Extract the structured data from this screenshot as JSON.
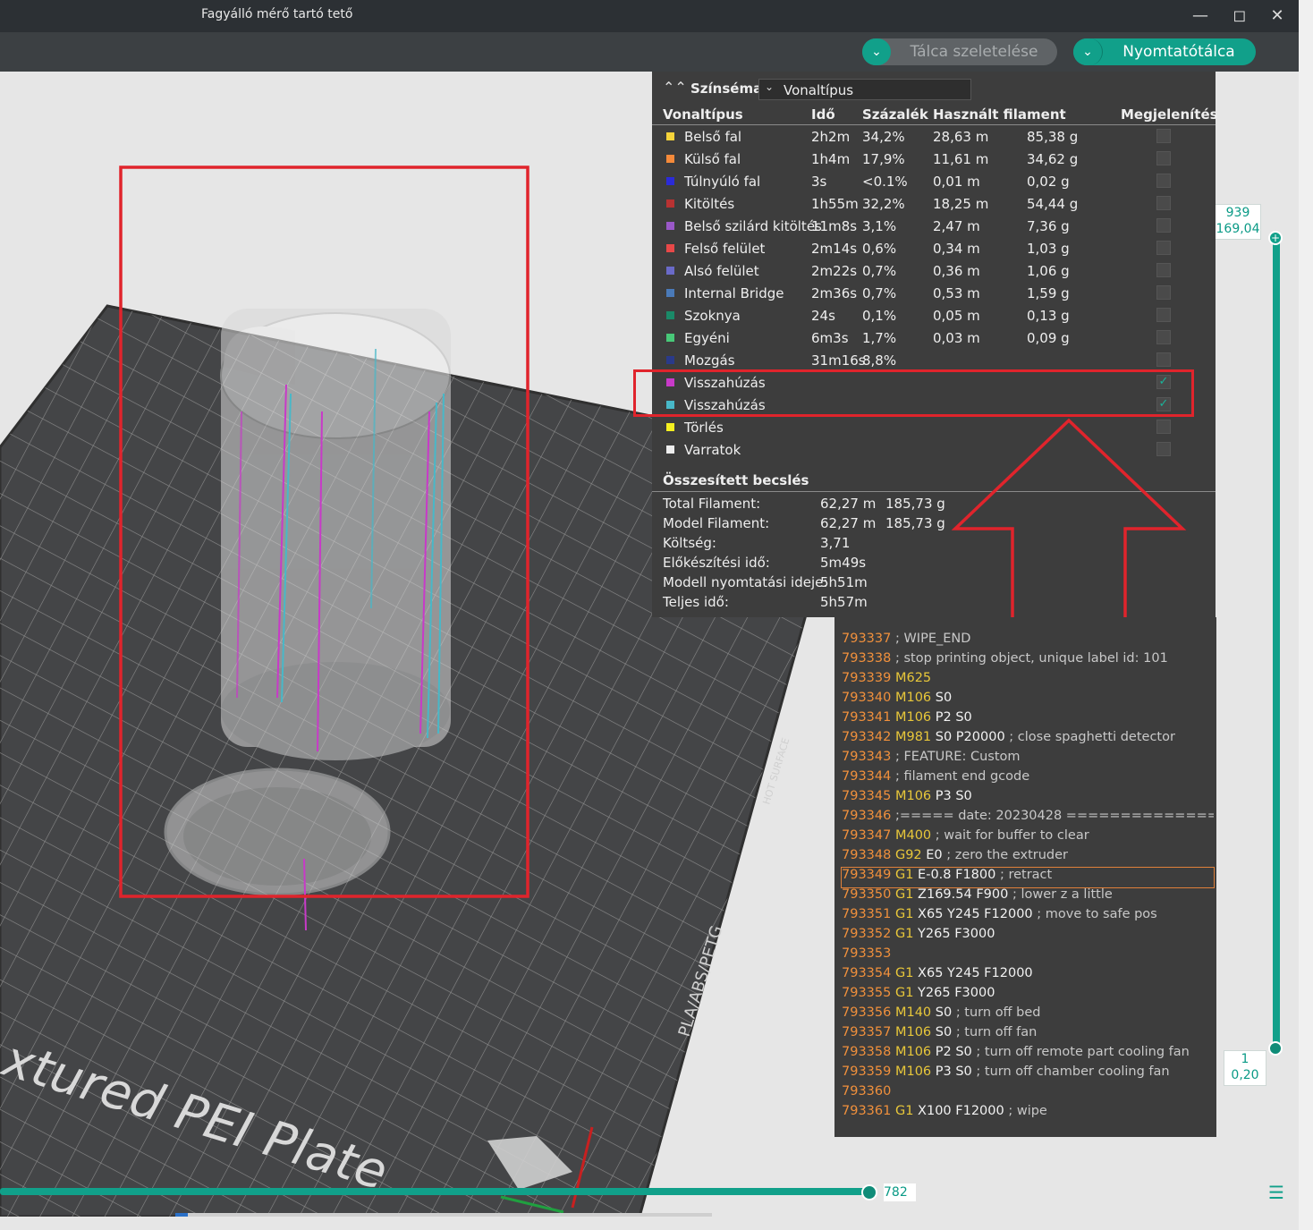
{
  "window": {
    "title": "Fagyálló mérő tartó tető",
    "minimize_icon": "minimize-icon",
    "maximize_icon": "maximize-icon",
    "close_icon": "close-icon"
  },
  "toolbar": {
    "slice_label": "Tálca szeletelése",
    "print_label": "Nyomtatótálca",
    "accent": "#11a08a"
  },
  "plate": {
    "label": "xtured PEI Plate",
    "side_label_1": "PLA/ABS/PETG",
    "side_label_2": "HOT SURFACE"
  },
  "legend": {
    "scheme_label": "Színséma",
    "scheme_value": "Vonaltípus",
    "columns": [
      "Vonaltípus",
      "Idő",
      "Százalék",
      "Használt filament",
      "Megjelenítés"
    ],
    "rows": [
      {
        "color": "#f5d33a",
        "name": "Belső fal",
        "time": "2h2m",
        "percent": "34,2%",
        "length": "28,63 m",
        "weight": "85,38 g",
        "shown": false
      },
      {
        "color": "#f58a3a",
        "name": "Külső fal",
        "time": "1h4m",
        "percent": "17,9%",
        "length": "11,61 m",
        "weight": "34,62 g",
        "shown": false
      },
      {
        "color": "#2b2bd8",
        "name": "Túlnyúló fal",
        "time": "3s",
        "percent": "<0.1%",
        "length": "0,01 m",
        "weight": "0,02 g",
        "shown": false
      },
      {
        "color": "#b83232",
        "name": "Kitöltés",
        "time": "1h55m",
        "percent": "32,2%",
        "length": "18,25 m",
        "weight": "54,44 g",
        "shown": false
      },
      {
        "color": "#9a58c8",
        "name": "Belső szilárd kitöltés",
        "time": "11m8s",
        "percent": "3,1%",
        "length": "2,47 m",
        "weight": "7,36 g",
        "shown": false
      },
      {
        "color": "#e84848",
        "name": "Felső felület",
        "time": "2m14s",
        "percent": "0,6%",
        "length": "0,34 m",
        "weight": "1,03 g",
        "shown": false
      },
      {
        "color": "#6a6ac8",
        "name": "Alsó felület",
        "time": "2m22s",
        "percent": "0,7%",
        "length": "0,36 m",
        "weight": "1,06 g",
        "shown": false
      },
      {
        "color": "#4a7ab8",
        "name": "Internal Bridge",
        "time": "2m36s",
        "percent": "0,7%",
        "length": "0,53 m",
        "weight": "1,59 g",
        "shown": false
      },
      {
        "color": "#1a8a68",
        "name": "Szoknya",
        "time": "24s",
        "percent": "0,1%",
        "length": "0,05 m",
        "weight": "0,13 g",
        "shown": false
      },
      {
        "color": "#48c878",
        "name": "Egyéni",
        "time": "6m3s",
        "percent": "1,7%",
        "length": "0,03 m",
        "weight": "0,09 g",
        "shown": false
      },
      {
        "color": "#2a3a8a",
        "name": "Mozgás",
        "time": "31m16s",
        "percent": "8,8%",
        "length": "",
        "weight": "",
        "shown": false
      },
      {
        "color": "#c83ac8",
        "name": "Visszahúzás",
        "time": "",
        "percent": "",
        "length": "",
        "weight": "",
        "shown": true
      },
      {
        "color": "#48b8c8",
        "name": "Visszahúzás",
        "time": "",
        "percent": "",
        "length": "",
        "weight": "",
        "shown": true
      },
      {
        "color": "#f5f020",
        "name": "Törlés",
        "time": "",
        "percent": "",
        "length": "",
        "weight": "",
        "shown": false
      },
      {
        "color": "#eeeeee",
        "name": "Varratok",
        "time": "",
        "percent": "",
        "length": "",
        "weight": "",
        "shown": false
      }
    ],
    "summary_title": "Összesített becslés",
    "summary": [
      {
        "label": "Total Filament:",
        "value": "62,27 m",
        "extra": "185,73 g"
      },
      {
        "label": "Model Filament:",
        "value": "62,27 m",
        "extra": "185,73 g"
      },
      {
        "label": "Költség:",
        "value": "3,71",
        "extra": ""
      },
      {
        "label": "Előkészítési idő:",
        "value": "5m49s",
        "extra": ""
      },
      {
        "label": "Modell nyomtatási ideje:",
        "value": "5h51m",
        "extra": ""
      },
      {
        "label": "Teljes idő:",
        "value": "5h57m",
        "extra": ""
      }
    ]
  },
  "gcode": [
    {
      "num": "793337",
      "cmd": "",
      "par": "",
      "cmt": "; WIPE_END"
    },
    {
      "num": "793338",
      "cmd": "",
      "par": "",
      "cmt": "; stop printing object, unique label id: 101"
    },
    {
      "num": "793339",
      "cmd": "M625",
      "par": "",
      "cmt": ""
    },
    {
      "num": "793340",
      "cmd": "M106",
      "par": "S0",
      "cmt": ""
    },
    {
      "num": "793341",
      "cmd": "M106",
      "par": "P2 S0",
      "cmt": ""
    },
    {
      "num": "793342",
      "cmd": "M981",
      "par": "S0 P20000",
      "cmt": "; close spaghetti detector"
    },
    {
      "num": "793343",
      "cmd": "",
      "par": "",
      "cmt": "; FEATURE: Custom"
    },
    {
      "num": "793344",
      "cmd": "",
      "par": "",
      "cmt": "; filament end gcode"
    },
    {
      "num": "793345",
      "cmd": "M106",
      "par": "P3 S0",
      "cmt": ""
    },
    {
      "num": "793346",
      "cmd": "",
      "par": "",
      "cmt": ";===== date: 20230428 ====================="
    },
    {
      "num": "793347",
      "cmd": "M400",
      "par": "",
      "cmt": "; wait for buffer to clear"
    },
    {
      "num": "793348",
      "cmd": "G92",
      "par": "E0",
      "cmt": "; zero the extruder"
    },
    {
      "num": "793349",
      "cmd": "G1",
      "par": "E-0.8 F1800",
      "cmt": "; retract",
      "selected": true
    },
    {
      "num": "793350",
      "cmd": "G1",
      "par": "Z169.54 F900",
      "cmt": "; lower z a little"
    },
    {
      "num": "793351",
      "cmd": "G1",
      "par": "X65 Y245 F12000",
      "cmt": "; move to safe pos"
    },
    {
      "num": "793352",
      "cmd": "G1",
      "par": "Y265 F3000",
      "cmt": ""
    },
    {
      "num": "793353",
      "cmd": "",
      "par": "",
      "cmt": ""
    },
    {
      "num": "793354",
      "cmd": "G1",
      "par": "X65 Y245 F12000",
      "cmt": ""
    },
    {
      "num": "793355",
      "cmd": "G1",
      "par": "Y265 F3000",
      "cmt": ""
    },
    {
      "num": "793356",
      "cmd": "M140",
      "par": "S0",
      "cmt": "; turn off bed"
    },
    {
      "num": "793357",
      "cmd": "M106",
      "par": "S0",
      "cmt": "; turn off fan"
    },
    {
      "num": "793358",
      "cmd": "M106",
      "par": "P2 S0",
      "cmt": "; turn off remote part cooling fan"
    },
    {
      "num": "793359",
      "cmd": "M106",
      "par": "P3 S0",
      "cmt": "; turn off chamber cooling fan"
    },
    {
      "num": "793360",
      "cmd": "",
      "par": "",
      "cmt": ""
    },
    {
      "num": "793361",
      "cmd": "G1",
      "par": "X100 F12000",
      "cmt": "; wipe"
    }
  ],
  "layer_slider": {
    "top_layer": "939",
    "top_height": "169,04",
    "bottom_layer": "1",
    "bottom_height": "0,20"
  },
  "move_slider": {
    "value": "782"
  },
  "annotation_color": "#e0242c"
}
